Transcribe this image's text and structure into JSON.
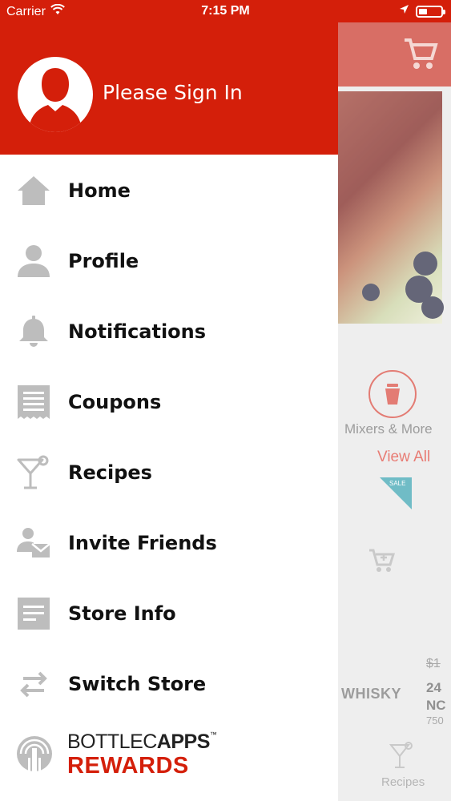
{
  "status_bar": {
    "carrier": "Carrier",
    "time": "7:15 PM"
  },
  "drawer": {
    "signin_text": "Please Sign In",
    "menu": [
      {
        "label": "Home",
        "icon": "home-icon"
      },
      {
        "label": "Profile",
        "icon": "person-icon"
      },
      {
        "label": "Notifications",
        "icon": "bell-icon"
      },
      {
        "label": "Coupons",
        "icon": "coupon-icon"
      },
      {
        "label": "Recipes",
        "icon": "cocktail-icon"
      },
      {
        "label": "Invite Friends",
        "icon": "invite-icon"
      },
      {
        "label": "Store Info",
        "icon": "document-icon"
      },
      {
        "label": "Switch Store",
        "icon": "switch-arrows-icon"
      }
    ],
    "rewards": {
      "brand_light": "BOTTLEC",
      "brand_bold": "APPS",
      "trademark": "™",
      "rewards_text": "REWARDS"
    }
  },
  "background": {
    "category_label": "Mixers & More",
    "view_all": "View All",
    "sale_badge": "SALE",
    "strike_price": "$1",
    "product_name": "WHISKY",
    "product_title_line1": "24",
    "product_title_line2": "NC",
    "product_size": "750",
    "tab_recipes": "Recipes"
  },
  "colors": {
    "brand_red": "#d41f0a",
    "icon_gray": "#b8b8b8"
  }
}
